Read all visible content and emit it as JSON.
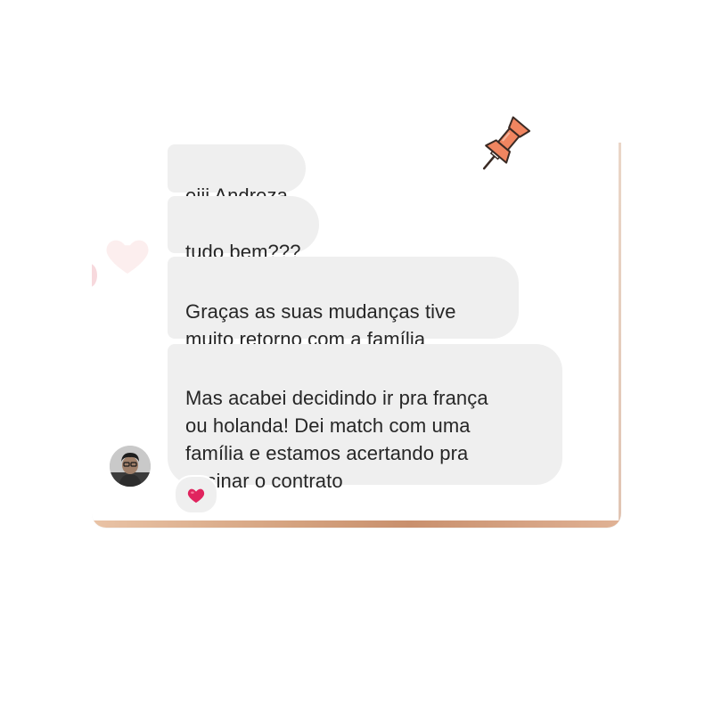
{
  "chat": {
    "messages": [
      {
        "text": "eiii Andreza"
      },
      {
        "text": "tudo bem???"
      },
      {
        "text": "Graças as suas mudanças tive\nmuito retorno com a família"
      },
      {
        "text": "Mas acabei decidindo ir pra frança\nou holanda! Dei match com uma\nfamília e estamos acertando pra\nassinar o contrato"
      }
    ],
    "reaction": {
      "icon": "heart-icon",
      "color": "#e0245e"
    },
    "sender_avatar": {
      "icon": "avatar"
    }
  },
  "decoration": {
    "pin": {
      "icon": "pushpin-icon",
      "color": "#f08560",
      "stroke": "#3a2a24"
    }
  },
  "colors": {
    "bubble": "#efefef",
    "text": "#262626"
  }
}
